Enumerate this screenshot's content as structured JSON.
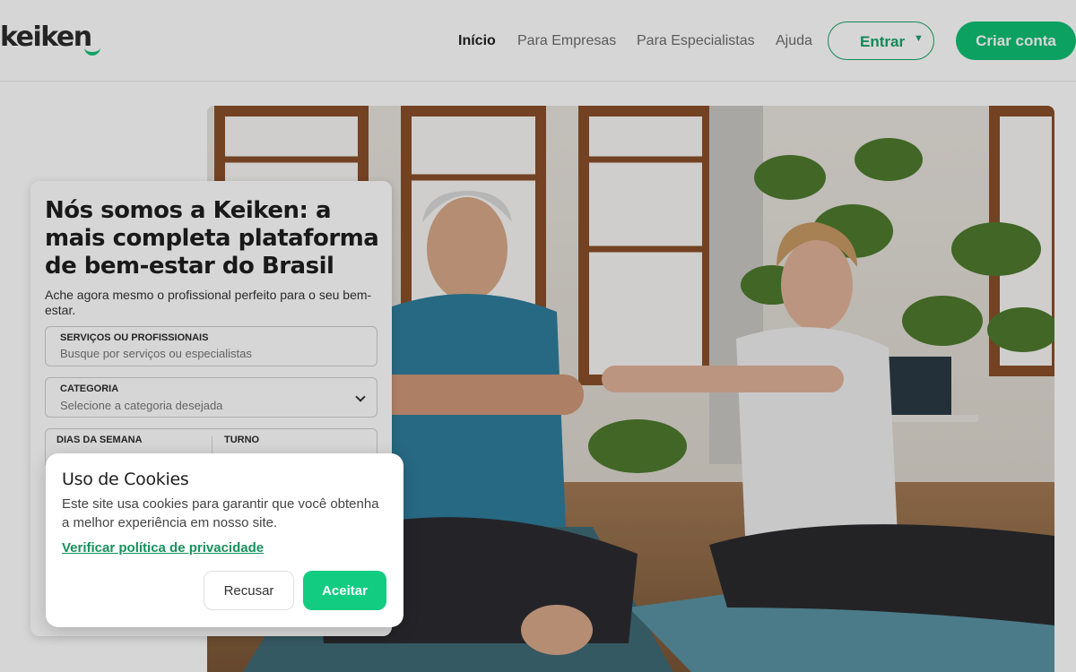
{
  "brand": {
    "logo_text": "keiken",
    "accent_color": "#0fbf74"
  },
  "nav": {
    "items": [
      "Início",
      "Para Empresas",
      "Para Especialistas",
      "Ajuda"
    ],
    "active": "Início",
    "login_label": "Entrar",
    "signup_label": "Criar conta"
  },
  "hero": {
    "title": "Nós somos a Keiken: a mais completa plataforma de bem-estar do Brasil",
    "subtitle": "Ache agora mesmo o profissional perfeito para o seu bem-estar.",
    "image_icon": "photo-seniors-stretching"
  },
  "search": {
    "service": {
      "label": "SERVIÇOS OU PROFISSIONAIS",
      "placeholder": "Busque por serviços ou especialistas"
    },
    "category": {
      "label": "CATEGORIA",
      "placeholder": "Selecione a categoria desejada"
    },
    "days": {
      "label": "DIAS DA SEMANA"
    },
    "shift": {
      "label": "TURNO"
    }
  },
  "cookie": {
    "title": "Uso de Cookies",
    "text": "Este site usa cookies para garantir que você obtenha a melhor experiência em nosso site.",
    "link": "Verificar política de privacidade",
    "decline": "Recusar",
    "accept": "Aceitar"
  }
}
